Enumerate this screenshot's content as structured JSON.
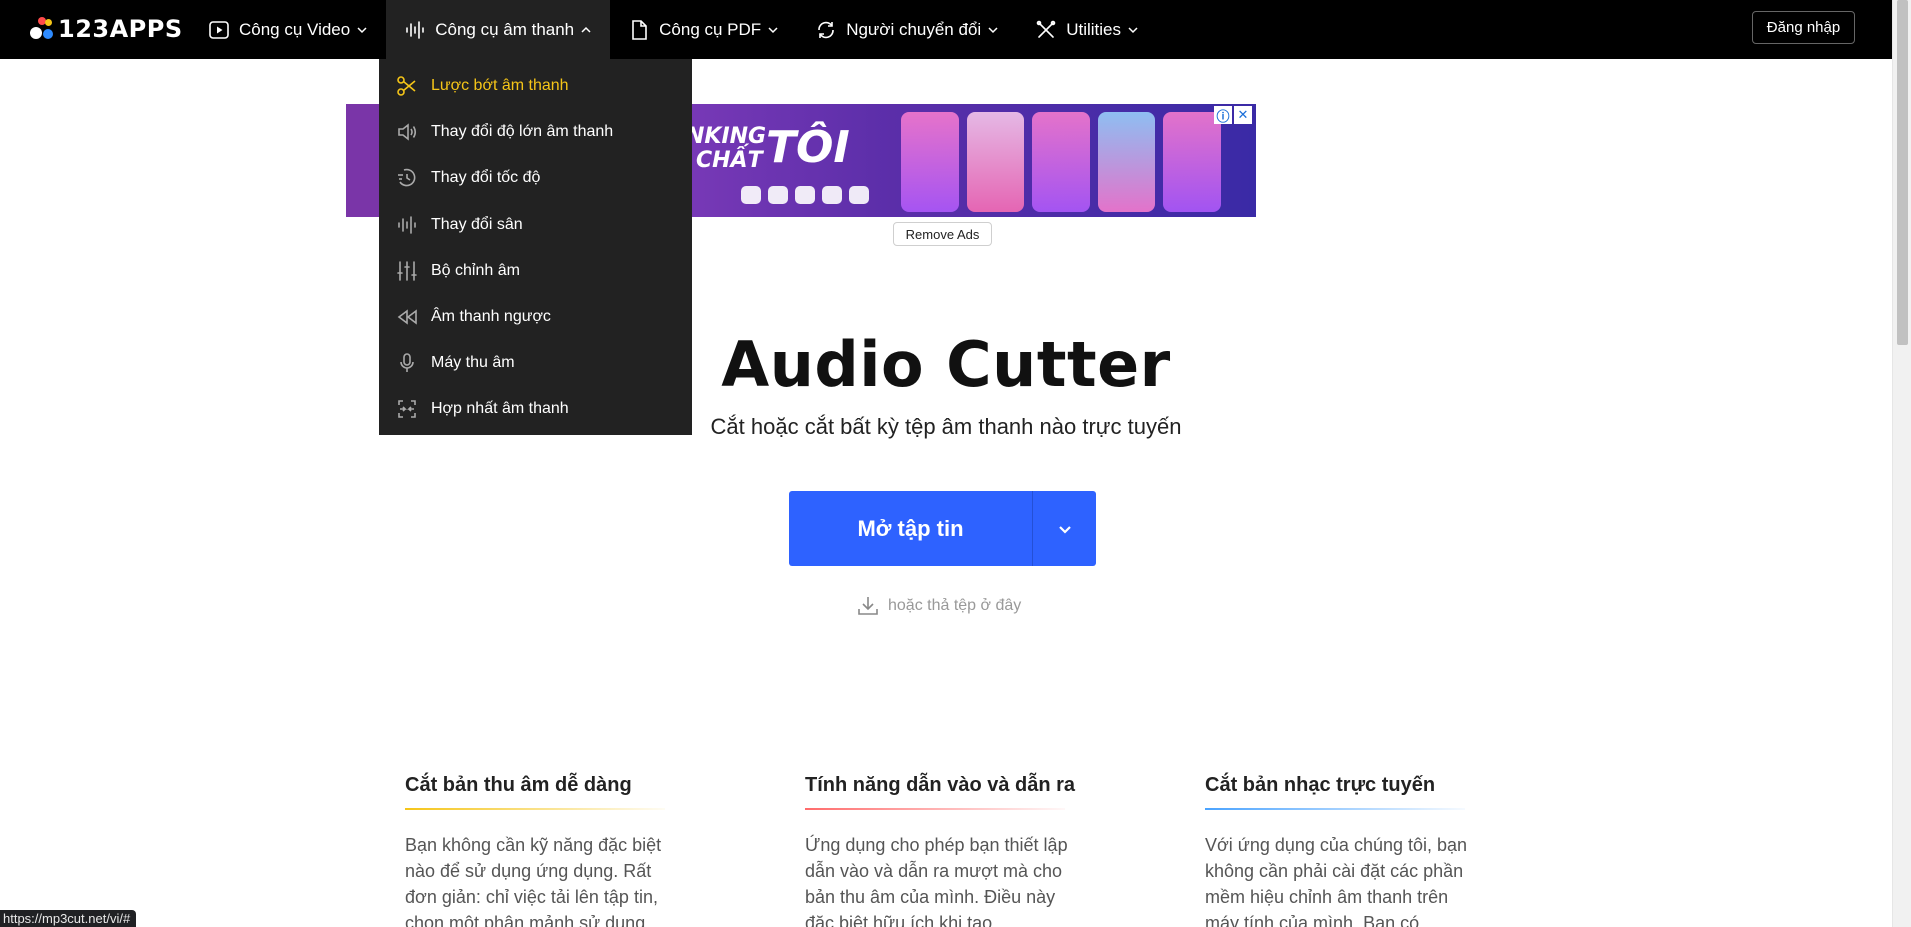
{
  "header": {
    "logo_text": "123APPS",
    "nav": [
      {
        "label": "Công cụ Video",
        "icon": "play-circle-icon"
      },
      {
        "label": "Công cụ âm thanh",
        "icon": "waveform-icon"
      },
      {
        "label": "Công cụ PDF",
        "icon": "document-icon"
      },
      {
        "label": "Người chuyển đổi",
        "icon": "convert-icon"
      },
      {
        "label": "Utilities",
        "icon": "tools-icon"
      }
    ],
    "login_label": "Đăng nhập"
  },
  "dropdown": {
    "items": [
      {
        "label": "Lược bớt âm thanh",
        "icon": "scissors-icon",
        "active": true
      },
      {
        "label": "Thay đổi độ lớn âm thanh",
        "icon": "volume-icon"
      },
      {
        "label": "Thay đổi tốc độ",
        "icon": "speed-icon"
      },
      {
        "label": "Thay đổi sân",
        "icon": "pitch-icon"
      },
      {
        "label": "Bộ chỉnh âm",
        "icon": "equalizer-icon"
      },
      {
        "label": "Âm thanh ngược",
        "icon": "reverse-icon"
      },
      {
        "label": "Máy thu âm",
        "icon": "microphone-icon"
      },
      {
        "label": "Hợp nhất âm thanh",
        "icon": "merge-icon"
      }
    ]
  },
  "ad": {
    "text_line1": "NKING",
    "text_line2": "CHẤT",
    "text_big": "TÔI",
    "remove_ads_label": "Remove Ads"
  },
  "hero": {
    "title": "Audio Cutter",
    "subtitle": "Cắt hoặc cắt bất kỳ tệp âm thanh nào trực tuyến",
    "open_button_label": "Mở tập tin",
    "drop_hint": "hoặc thả tệp ở đây"
  },
  "features": [
    {
      "title": "Cắt bản thu âm dễ dàng",
      "text": "Bạn không cần kỹ năng đặc biệt nào để sử dụng ứng dụng. Rất đơn giản: chỉ việc tải lên tập tin, chọn một phân mảnh sử dụng",
      "accent": "#f5c518"
    },
    {
      "title": "Tính năng dẫn vào và dẫn ra",
      "text": "Ứng dụng cho phép bạn thiết lập dẫn vào và dẫn ra mượt mà cho bản thu âm của mình. Điều này đặc biệt hữu ích khi tạo",
      "accent": "#ff6b6b"
    },
    {
      "title": "Cắt bản nhạc trực tuyến",
      "text": "Với ứng dụng của chúng tôi, bạn không cần phải cài đặt các phần mềm hiệu chỉnh âm thanh trên máy tính của mình. Bạn có",
      "accent": "#4aa3ff"
    }
  ],
  "status_url": "https://mp3cut.net/vi/#"
}
